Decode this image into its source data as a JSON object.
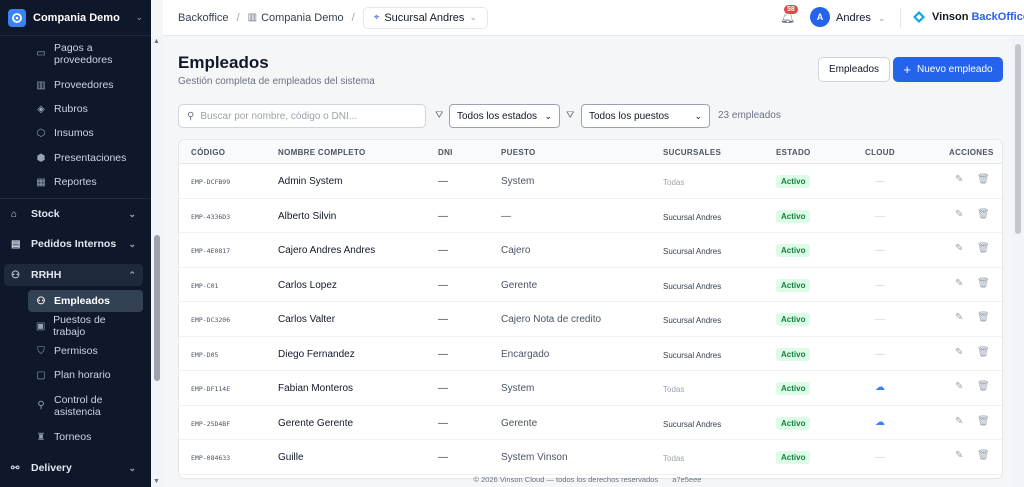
{
  "brand": {
    "name": "Compania Demo"
  },
  "sidebar": {
    "items": [
      {
        "label": "Pagos a proveedores",
        "icon": "wallet-icon"
      },
      {
        "label": "Proveedores",
        "icon": "building-icon"
      },
      {
        "label": "Rubros",
        "icon": "layers-icon"
      },
      {
        "label": "Insumos",
        "icon": "box-icon"
      },
      {
        "label": "Presentaciones",
        "icon": "package-icon"
      },
      {
        "label": "Reportes",
        "icon": "chart-icon"
      }
    ],
    "groups": [
      {
        "label": "Stock",
        "icon": "warehouse-icon"
      },
      {
        "label": "Pedidos Internos",
        "icon": "clipboard-icon"
      },
      {
        "label": "RRHH",
        "icon": "users-icon"
      }
    ],
    "rrhh_items": [
      {
        "label": "Empleados",
        "icon": "users-icon"
      },
      {
        "label": "Puestos de trabajo",
        "icon": "briefcase-icon"
      },
      {
        "label": "Permisos",
        "icon": "shield-icon"
      },
      {
        "label": "Plan horario",
        "icon": "calendar-icon"
      },
      {
        "label": "Control de asistencia",
        "icon": "user-check-icon"
      },
      {
        "label": "Torneos",
        "icon": "trophy-icon"
      }
    ],
    "delivery": {
      "label": "Delivery",
      "icon": "bike-icon"
    }
  },
  "topbar": {
    "crumb_root": "Backoffice",
    "crumb_company": "Compania Demo",
    "sucursal": "Sucursal Andres",
    "notifications": "58",
    "user_initial": "A",
    "user_name": "Andres",
    "product_a": "Vinson",
    "product_b": "BackOffice"
  },
  "page": {
    "title": "Empleados",
    "subtitle": "Gestión completa de empleados del sistema",
    "btn_secondary": "Empleados",
    "btn_primary": "Nuevo empleado",
    "search_placeholder": "Buscar por nombre, código o DNI...",
    "filter_state": "Todos los estados",
    "filter_position": "Todos los puestos",
    "count": "23 empleados"
  },
  "table": {
    "headers": [
      "CÓDIGO",
      "NOMBRE COMPLETO",
      "DNI",
      "PUESTO",
      "SUCURSALES",
      "ESTADO",
      "CLOUD",
      "ACCIONES"
    ],
    "rows": [
      {
        "code": "EMP-DCFB99",
        "name": "Admin System",
        "dni": "—",
        "position": "System",
        "branch": "Todas",
        "status": "Activo",
        "cloud": "—"
      },
      {
        "code": "EMP-4336D3",
        "name": "Alberto Silvin",
        "dni": "—",
        "position": "—",
        "branch": "Sucursal Andres",
        "status": "Activo",
        "cloud": "—"
      },
      {
        "code": "EMP-4E0817",
        "name": "Cajero Andres Andres",
        "dni": "—",
        "position": "Cajero",
        "branch": "Sucursal Andres",
        "status": "Activo",
        "cloud": "—"
      },
      {
        "code": "EMP-C01",
        "name": "Carlos Lopez",
        "dni": "—",
        "position": "Gerente",
        "branch": "Sucursal Andres",
        "status": "Activo",
        "cloud": "—"
      },
      {
        "code": "EMP-DC3206",
        "name": "Carlos Valter",
        "dni": "—",
        "position": "Cajero Nota de credito",
        "branch": "Sucursal Andres",
        "status": "Activo",
        "cloud": "—"
      },
      {
        "code": "EMP-D05",
        "name": "Diego Fernandez",
        "dni": "—",
        "position": "Encargado",
        "branch": "Sucursal Andres",
        "status": "Activo",
        "cloud": "—"
      },
      {
        "code": "EMP-DF114E",
        "name": "Fabian Monteros",
        "dni": "—",
        "position": "System",
        "branch": "Todas",
        "status": "Activo",
        "cloud": "☁"
      },
      {
        "code": "EMP-25D4BF",
        "name": "Gerente Gerente",
        "dni": "—",
        "position": "Gerente",
        "branch": "Sucursal Andres",
        "status": "Activo",
        "cloud": "☁"
      },
      {
        "code": "EMP-084633",
        "name": "Guille",
        "dni": "—",
        "position": "System Vinson",
        "branch": "Todas",
        "status": "Activo",
        "cloud": "—"
      }
    ]
  },
  "footer": {
    "text": "© 2026 Vinson Cloud — todos los derechos reservados",
    "version": "a7e5eee"
  }
}
